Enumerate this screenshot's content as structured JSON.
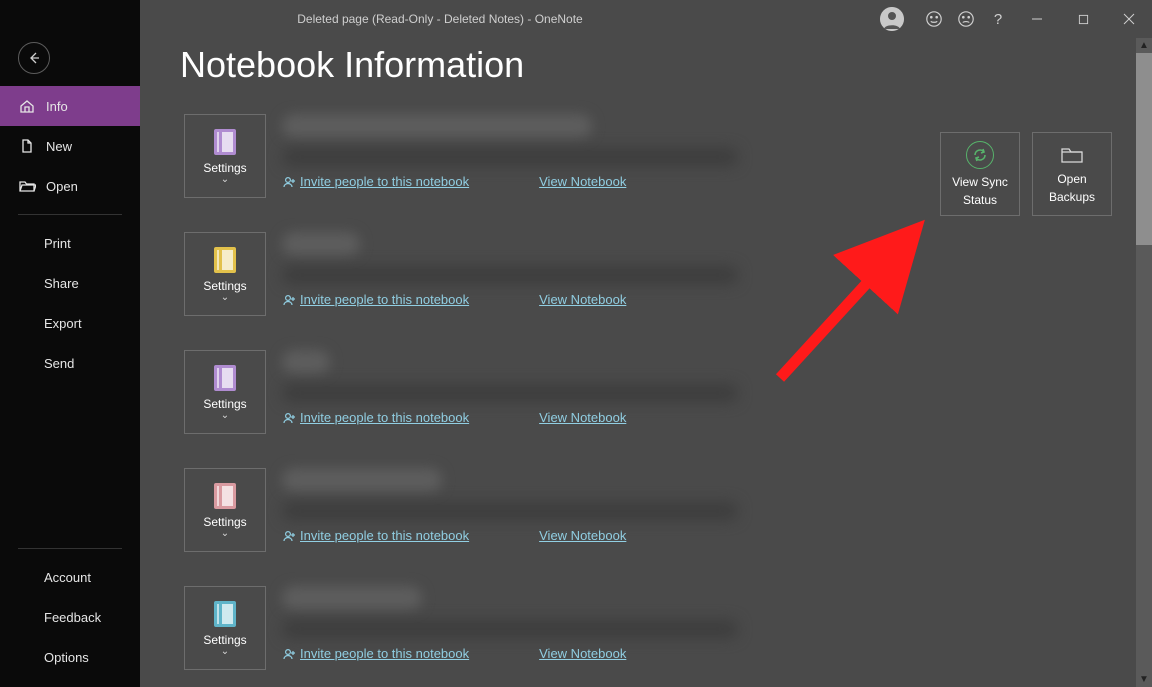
{
  "titlebar": {
    "title": "Deleted page (Read-Only - Deleted Notes)  -  OneNote"
  },
  "sidebar": {
    "main": [
      {
        "icon": "home",
        "label": "Info",
        "active": true
      },
      {
        "icon": "doc",
        "label": "New"
      },
      {
        "icon": "open",
        "label": "Open"
      }
    ],
    "secondary": [
      {
        "label": "Print"
      },
      {
        "label": "Share"
      },
      {
        "label": "Export"
      },
      {
        "label": "Send"
      }
    ],
    "bottom": [
      {
        "label": "Account"
      },
      {
        "label": "Feedback"
      },
      {
        "label": "Options"
      }
    ]
  },
  "page": {
    "title": "Notebook Information"
  },
  "right_buttons": {
    "sync": {
      "line1": "View Sync",
      "line2": "Status"
    },
    "backups": {
      "line1": "Open",
      "line2": "Backups"
    }
  },
  "notebooks": [
    {
      "color": "#b08cd1",
      "settings_label": "Settings",
      "title_w": "w1"
    },
    {
      "color": "#e2c14b",
      "settings_label": "Settings",
      "title_w": "w2"
    },
    {
      "color": "#b08cd1",
      "settings_label": "Settings",
      "title_w": "w3"
    },
    {
      "color": "#d99aa0",
      "settings_label": "Settings",
      "title_w": "w4"
    },
    {
      "color": "#5fb4c9",
      "settings_label": "Settings",
      "title_w": "w5"
    }
  ],
  "links": {
    "invite": "Invite people to this notebook",
    "view": "View Notebook"
  }
}
